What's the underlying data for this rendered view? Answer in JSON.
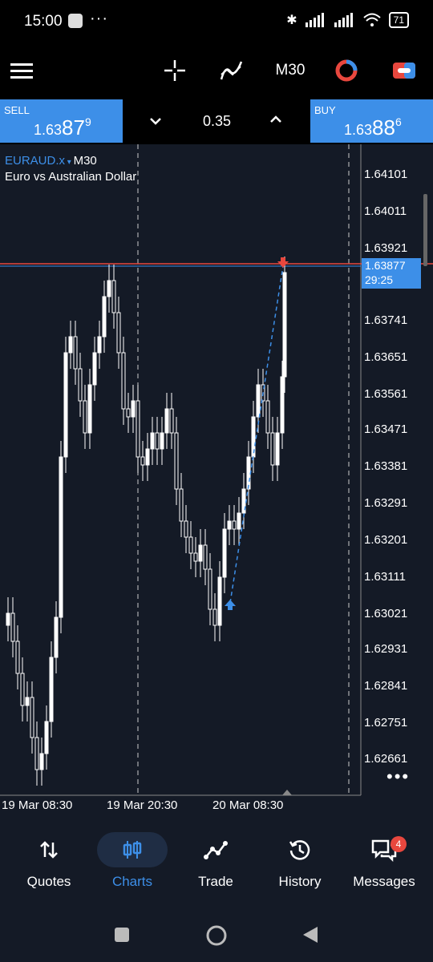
{
  "status": {
    "time": "15:00",
    "dots": "···",
    "battery": "71"
  },
  "toolbar": {
    "timeframe": "M30"
  },
  "quotes": {
    "sell": {
      "label": "SELL",
      "price_prefix": "1.63",
      "price_big": "87",
      "price_sup": "9"
    },
    "buy": {
      "label": "BUY",
      "price_prefix": "1.63",
      "price_big": "88",
      "price_sup": "6"
    },
    "lot": "0.35"
  },
  "chart": {
    "symbol": "EURAUD.x",
    "timeframe": "M30",
    "description": "Euro vs Australian Dollar",
    "y_ticks": [
      "1.64101",
      "1.64011",
      "1.63921",
      "1.63741",
      "1.63651",
      "1.63561",
      "1.63471",
      "1.63381",
      "1.63291",
      "1.63201",
      "1.63111",
      "1.63021",
      "1.62931",
      "1.62841",
      "1.62751",
      "1.62661"
    ],
    "x_ticks": [
      "19 Mar 08:30",
      "19 Mar 20:30",
      "20 Mar 08:30"
    ],
    "current_price": "1.63877",
    "countdown": "29:25",
    "accent": "#3d8fe8",
    "bid_line_color": "#e8473e"
  },
  "nav": {
    "items": [
      {
        "label": "Quotes"
      },
      {
        "label": "Charts"
      },
      {
        "label": "Trade"
      },
      {
        "label": "History"
      },
      {
        "label": "Messages",
        "badge": "4"
      }
    ]
  }
}
